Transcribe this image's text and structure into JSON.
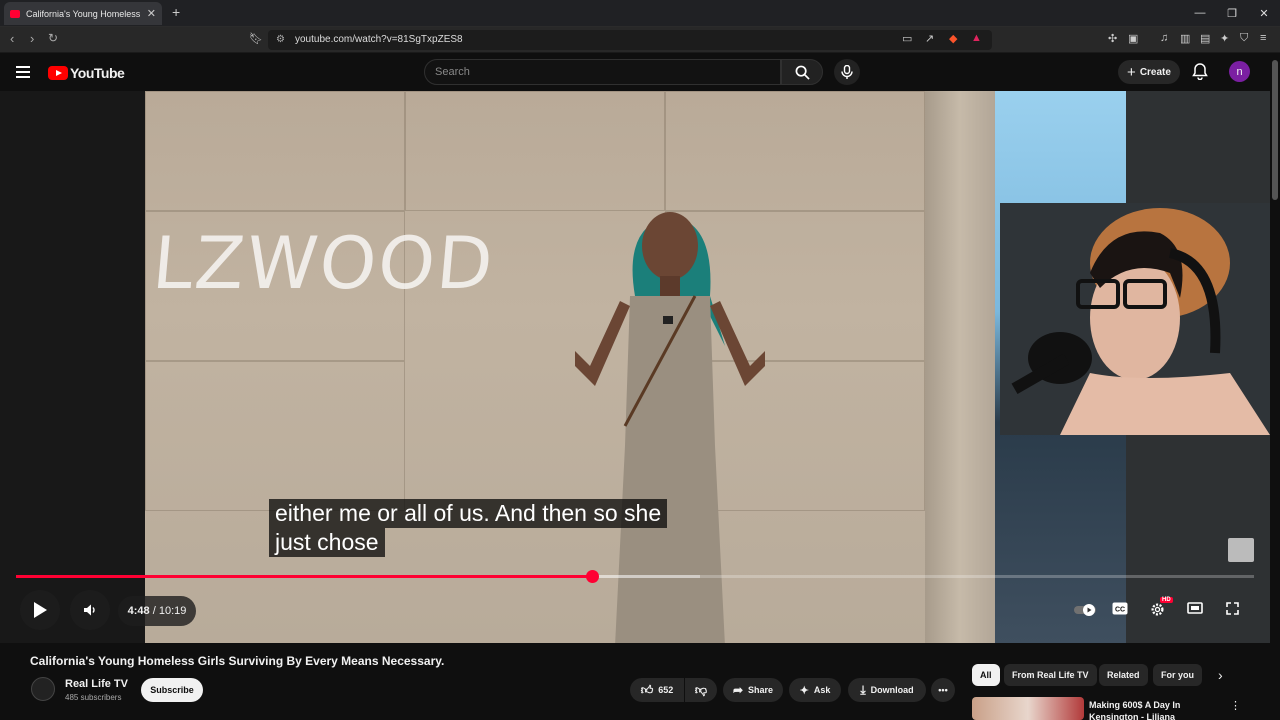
{
  "browser": {
    "tab_title": "California's Young Homeless Girls",
    "url": "youtube.com/watch?v=81SgTxpZES8"
  },
  "youtube": {
    "logo_text": "YouTube",
    "search_placeholder": "Search",
    "create_label": "Create",
    "avatar_letter": "n"
  },
  "player": {
    "caption_line1": "either me or all of us. And then so she",
    "caption_line2": "just chose",
    "current_time": "4:48",
    "duration": "10:19",
    "progress_fraction": 0.465,
    "hd_badge": "HD",
    "graffiti": "LZWOOD"
  },
  "video": {
    "title": "California's Young Homeless Girls Surviving By Every Means Necessary.",
    "channel_name": "Real Life TV",
    "subscribers": "485 subscribers",
    "subscribe_label": "Subscribe",
    "like_count": "652",
    "share_label": "Share",
    "ask_label": "Ask",
    "download_label": "Download"
  },
  "chips": [
    "All",
    "From Real Life TV",
    "Related",
    "For you"
  ],
  "recommendation": {
    "title": "Making 600$ A Day In Kensington - Liliana"
  },
  "colors": {
    "accent": "#ff0033",
    "background": "#0f0f0f"
  }
}
